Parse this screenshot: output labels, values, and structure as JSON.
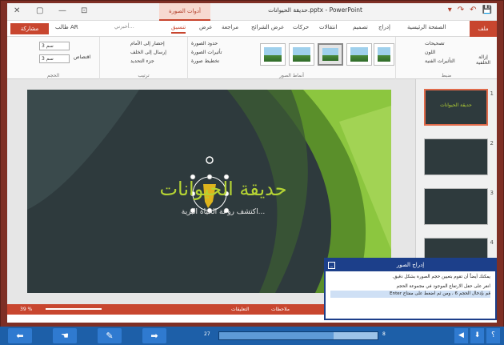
{
  "window": {
    "doc_title": "حديقة الحيوانات.pptx - PowerPoint",
    "picture_tools": "أدوات الصورة",
    "controls": {
      "close": "✕",
      "restore": "▢",
      "minimize": "—",
      "dock": "⊡"
    },
    "qat": {
      "undo": "↶",
      "redo": "↷",
      "save": "💾",
      "start": "▾"
    }
  },
  "tabs": {
    "share": "مشاركة",
    "user": "طالب AR",
    "tell_me": "أخبرني...",
    "items": [
      "ملف",
      "الصفحة الرئيسية",
      "إدراج",
      "تصميم",
      "انتقالات",
      "حركات",
      "عرض الشرائح",
      "مراجعة",
      "عرض",
      "تنسيق"
    ],
    "active": "تنسيق"
  },
  "ribbon": {
    "groups": {
      "size": "الحجم",
      "arrange": "ترتيب",
      "styles": "أنماط الصور",
      "adjust": "ضبط"
    },
    "size": {
      "height": "3 سم",
      "width": "3 سم",
      "crop": "اقتصاص"
    },
    "arrange": {
      "bring_forward": "إحضار إلى الأمام",
      "send_backward": "إرسال إلى الخلف",
      "selection_pane": "جزء التحديد"
    },
    "styles": {
      "border": "حدود الصورة",
      "effects": "تأثيرات الصورة",
      "layout": "تخطيط صورة"
    },
    "adjust": {
      "corrections": "تصحيحات",
      "color": "اللون",
      "artistic": "التأثيرات الفنية",
      "remove_bg": "إزالة الخلفية"
    }
  },
  "slide": {
    "title": "حديقة الحيوانات",
    "subtitle": "اكتشف روعة الحياة البرية..."
  },
  "thumbnails": [
    {
      "num": "1",
      "title": "حديقة الحيوانات"
    },
    {
      "num": "2",
      "title": ""
    },
    {
      "num": "3",
      "title": ""
    },
    {
      "num": "4",
      "title": ""
    }
  ],
  "popup": {
    "title": "إدراج الصور",
    "intro": "يمكنك أيضاً أن تقوم بتعيين حجم الصورة بشكل دقيق.",
    "step1": "انقر على حقل الارتفاع الموجود في مجموعة الحجم",
    "step2": "قم بإدخال الحجم 6 ، ومن ثم اضغط على مفتاح Enter",
    "min": "_"
  },
  "status": {
    "zoom": "39 %",
    "notes": "ملاحظات",
    "comments": "التعليقات"
  },
  "nav": {
    "page_left": "27",
    "page_right": "8",
    "progress": 0.72,
    "help": "؟"
  },
  "colors": {
    "accent": "#c8462f",
    "nav": "#1d5fa8",
    "slide_title": "#b5d334"
  }
}
